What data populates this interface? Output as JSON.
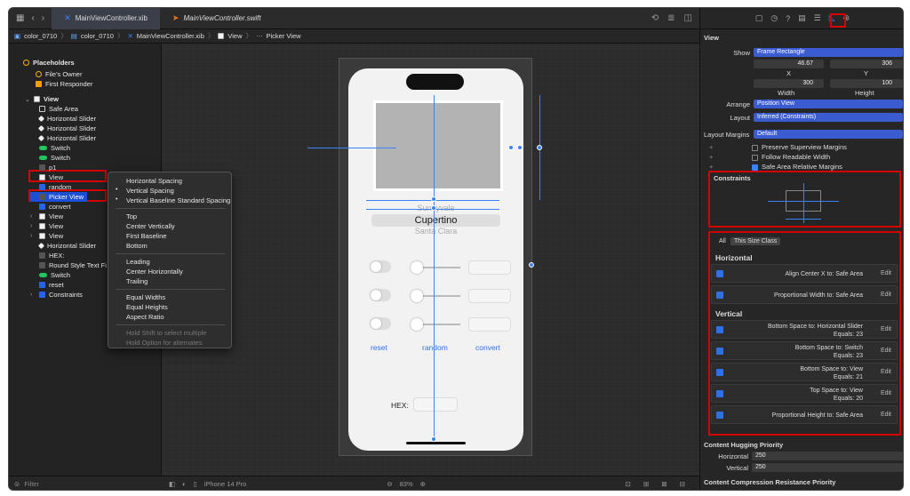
{
  "tabs": [
    {
      "label": "MainViewController.xib",
      "active": true
    },
    {
      "label": "MainViewController.swift",
      "active": false
    }
  ],
  "jumpbar": [
    "color_0710",
    "color_0710",
    "MainViewController.xib",
    "View",
    "Picker View"
  ],
  "navigator": {
    "placeholders_label": "Placeholders",
    "files_owner": "File's Owner",
    "first_responder": "First Responder",
    "items": [
      {
        "label": "View",
        "indent": 1,
        "icon": "white",
        "bold": true,
        "caret": "v"
      },
      {
        "label": "Safe Area",
        "indent": 2,
        "icon": "outline"
      },
      {
        "label": "Horizontal Slider",
        "indent": 2,
        "icon": "diamond"
      },
      {
        "label": "Horizontal Slider",
        "indent": 2,
        "icon": "diamond"
      },
      {
        "label": "Horizontal Slider",
        "indent": 2,
        "icon": "diamond"
      },
      {
        "label": "Switch",
        "indent": 2,
        "icon": "green"
      },
      {
        "label": "Switch",
        "indent": 2,
        "icon": "green"
      },
      {
        "label": "p1",
        "indent": 2,
        "icon": "dark"
      },
      {
        "label": "View",
        "indent": 2,
        "icon": "white"
      },
      {
        "label": "random",
        "indent": 2,
        "icon": "blue"
      },
      {
        "label": "Picker View",
        "indent": 2,
        "icon": "dark",
        "selected": true
      },
      {
        "label": "convert",
        "indent": 2,
        "icon": "blue"
      },
      {
        "label": "View",
        "indent": 2,
        "icon": "white",
        "caret": ">"
      },
      {
        "label": "View",
        "indent": 2,
        "icon": "white",
        "caret": ">"
      },
      {
        "label": "View",
        "indent": 2,
        "icon": "white",
        "caret": ">"
      },
      {
        "label": "Horizontal Slider",
        "indent": 2,
        "icon": "diamond"
      },
      {
        "label": "HEX:",
        "indent": 2,
        "icon": "dark"
      },
      {
        "label": "Round Style Text Fi",
        "indent": 2,
        "icon": "dark"
      },
      {
        "label": "Switch",
        "indent": 2,
        "icon": "green"
      },
      {
        "label": "reset",
        "indent": 2,
        "icon": "blue"
      },
      {
        "label": "Constraints",
        "indent": 2,
        "icon": "blue",
        "caret": ">"
      }
    ],
    "filter_placeholder": "Filter"
  },
  "context_menu": {
    "items": [
      {
        "label": "Horizontal Spacing",
        "y": 0
      },
      {
        "label": "Vertical Spacing",
        "y": 1,
        "dot": true
      },
      {
        "label": "Vertical Baseline Standard Spacing",
        "y": 2,
        "dot": true
      },
      {
        "label": "Top"
      },
      {
        "label": "Center Vertically"
      },
      {
        "label": "First Baseline"
      },
      {
        "label": "Bottom"
      },
      {
        "label": "Leading"
      },
      {
        "label": "Center Horizontally"
      },
      {
        "label": "Trailing"
      },
      {
        "label": "Equal Widths"
      },
      {
        "label": "Equal Heights"
      },
      {
        "label": "Aspect Ratio"
      },
      {
        "label": "Hold Shift to select multiple",
        "dim": true
      },
      {
        "label": "Hold Option for alternates",
        "dim": true
      }
    ]
  },
  "phone": {
    "picker_rows": [
      "Sunnyvale",
      "Cupertino",
      "Santa Clara"
    ],
    "buttons": [
      "reset",
      "random",
      "convert"
    ],
    "hex_label": "HEX:"
  },
  "canvas_footer": {
    "device": "iPhone 14 Pro",
    "zoom": "83%"
  },
  "inspector": {
    "section_title": "View",
    "show_label": "Show",
    "show_value": "Frame Rectangle",
    "x_value": "46.67",
    "y_value": "306",
    "x_label": "X",
    "y_label": "Y",
    "width_value": "300",
    "height_value": "100",
    "width_label": "Width",
    "height_label": "Height",
    "arrange_label": "Arrange",
    "arrange_value": "Position View",
    "layout_label": "Layout",
    "layout_value": "Inferred (Constraints)",
    "margins_label": "Layout Margins",
    "margins_value": "Default",
    "checks": [
      {
        "label": "Preserve Superview Margins",
        "on": false
      },
      {
        "label": "Follow Readable Width",
        "on": false
      },
      {
        "label": "Safe Area Relative Margins",
        "on": true
      }
    ],
    "constraints_title": "Constraints",
    "seg_all": "All",
    "seg_size_class": "This Size Class",
    "horizontal_label": "Horizontal",
    "vertical_label": "Vertical",
    "edit_label": "Edit",
    "horizontal_constraints": [
      {
        "line1": "Align Center X to:  Safe Area",
        "line2": ""
      },
      {
        "line1": "Proportional Width to:  Safe Area",
        "line2": ""
      }
    ],
    "vertical_constraints": [
      {
        "line1": "Bottom Space to:  Horizontal Slider",
        "line2": "Equals:  23"
      },
      {
        "line1": "Bottom Space to:  Switch",
        "line2": "Equals:  23"
      },
      {
        "line1": "Bottom Space to:  View",
        "line2": "Equals:  21"
      },
      {
        "line1": "Top Space to:  View",
        "line2": "Equals:  20"
      },
      {
        "line1": "Proportional Height to:  Safe Area",
        "line2": ""
      }
    ],
    "hugging_title": "Content Hugging Priority",
    "hug_h_label": "Horizontal",
    "hug_h_value": "250",
    "hug_v_label": "Vertical",
    "hug_v_value": "250",
    "compression_title": "Content Compression Resistance Priority"
  }
}
